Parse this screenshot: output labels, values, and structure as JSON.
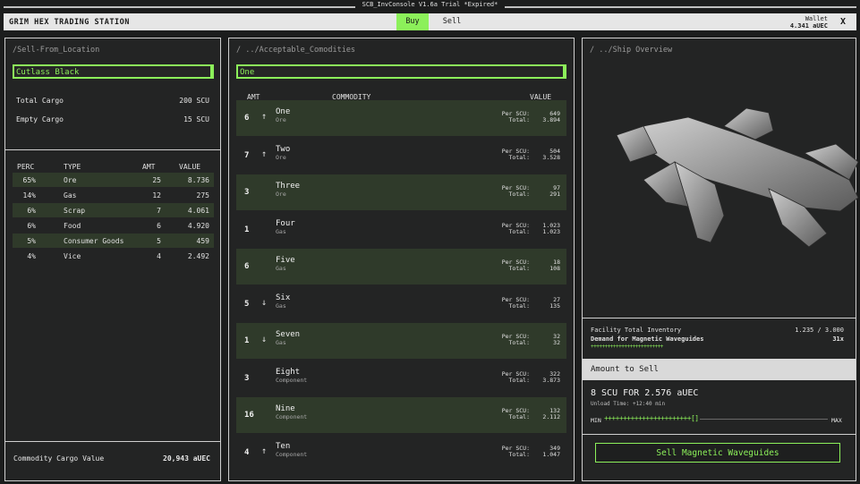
{
  "window": {
    "title": "SCB_InvConsole V1.6a Trial *Expired*"
  },
  "header": {
    "station": "GRIM HEX TRADING STATION",
    "tabs": {
      "buy": "Buy",
      "sell": "Sell"
    },
    "wallet_label": "Wallet",
    "wallet_value": "4.341 aUEC",
    "close": "X"
  },
  "left": {
    "title": "/Sell-From_Location",
    "location": "Cutlass Black",
    "total_cargo_label": "Total Cargo",
    "total_cargo_value": "200 SCU",
    "empty_cargo_label": "Empty Cargo",
    "empty_cargo_value": "15 SCU",
    "columns": {
      "perc": "PERC",
      "type": "TYPE",
      "amt": "AMT",
      "value": "VALUE"
    },
    "rows": [
      {
        "perc": "65%",
        "type": "Ore",
        "amt": "25",
        "value": "8.736"
      },
      {
        "perc": "14%",
        "type": "Gas",
        "amt": "12",
        "value": "275"
      },
      {
        "perc": "6%",
        "type": "Scrap",
        "amt": "7",
        "value": "4.061"
      },
      {
        "perc": "6%",
        "type": "Food",
        "amt": "6",
        "value": "4.920"
      },
      {
        "perc": "5%",
        "type": "Consumer Goods",
        "amt": "5",
        "value": "459"
      },
      {
        "perc": "4%",
        "type": "Vice",
        "amt": "4",
        "value": "2.492"
      }
    ],
    "footer_label": "Commodity Cargo Value",
    "footer_value": "20,943 aUEC"
  },
  "middle": {
    "title": "/ ../Acceptable_Comodities",
    "selected": "One",
    "columns": {
      "amt": "AMT",
      "commodity": "COMMODITY",
      "value": "VALUE"
    },
    "per_scu_label": "Per SCU:",
    "total_label": "Total:",
    "rows": [
      {
        "amt": "6",
        "arrow": "↑",
        "name": "One",
        "type": "Ore",
        "per": "649",
        "total": "3.894"
      },
      {
        "amt": "7",
        "arrow": "↑",
        "name": "Two",
        "type": "Ore",
        "per": "504",
        "total": "3.528"
      },
      {
        "amt": "3",
        "arrow": "",
        "name": "Three",
        "type": "Ore",
        "per": "97",
        "total": "291"
      },
      {
        "amt": "1",
        "arrow": "",
        "name": "Four",
        "type": "Gas",
        "per": "1.023",
        "total": "1.023"
      },
      {
        "amt": "6",
        "arrow": "",
        "name": "Five",
        "type": "Gas",
        "per": "18",
        "total": "108"
      },
      {
        "amt": "5",
        "arrow": "↓",
        "name": "Six",
        "type": "Gas",
        "per": "27",
        "total": "135"
      },
      {
        "amt": "1",
        "arrow": "↓",
        "name": "Seven",
        "type": "Gas",
        "per": "32",
        "total": "32"
      },
      {
        "amt": "3",
        "arrow": "",
        "name": "Eight",
        "type": "Component",
        "per": "322",
        "total": "3.873"
      },
      {
        "amt": "16",
        "arrow": "",
        "name": "Nine",
        "type": "Component",
        "per": "132",
        "total": "2.112"
      },
      {
        "amt": "4",
        "arrow": "↑",
        "name": "Ten",
        "type": "Component",
        "per": "349",
        "total": "1.047"
      }
    ]
  },
  "right": {
    "title": "/ ../Ship Overview",
    "facility_label": "Facility Total Inventory",
    "facility_value": "1.235 / 3.000",
    "demand_label": "Demand for Magnetic Waveguides",
    "demand_value": "31x",
    "demand_bar": "++++++++++++++++++++++++++",
    "amount_header": "Amount to Sell",
    "amount_text": "8 SCU FOR 2.576 aUEC",
    "unload_text": "Unload Time: +12:40 min",
    "slider_min": "MIN",
    "slider_max": "MAX",
    "slider_marks": "+++++++++++++++++++++++[]",
    "sell_button": "Sell Magnetic Waveguides"
  },
  "colors": {
    "accent": "#8cf05a",
    "row_alt": "#2f3a2a",
    "panel_bg": "#232424",
    "page_bg": "#1c1d1d",
    "header_bg": "#e6e6e6"
  }
}
